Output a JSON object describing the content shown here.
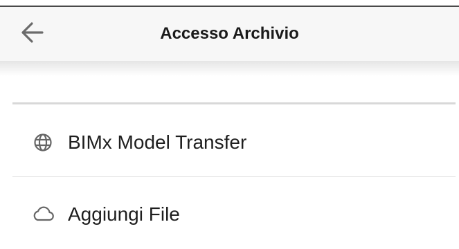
{
  "header": {
    "title": "Accesso Archivio",
    "back_icon": "arrow-left-icon"
  },
  "list": {
    "items": [
      {
        "label": "BIMx Model Transfer",
        "icon": "globe-icon"
      },
      {
        "label": "Aggiungi File",
        "icon": "cloud-icon"
      }
    ]
  },
  "colors": {
    "app_bar_bg": "#f7f7f7",
    "text": "#1e1e1e",
    "icon": "#666666",
    "divider": "#dddddd"
  }
}
